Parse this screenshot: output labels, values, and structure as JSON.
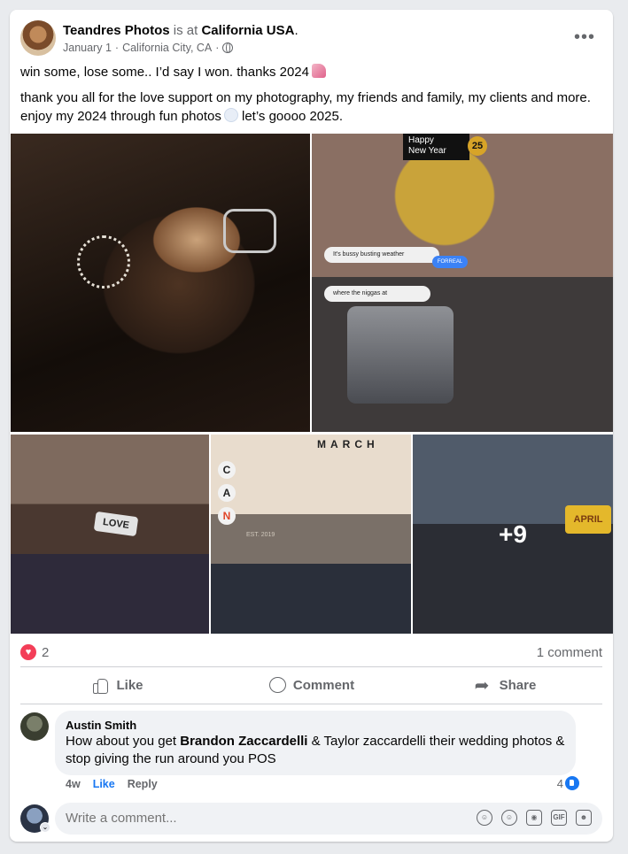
{
  "post": {
    "author": "Teandres Photos",
    "is_at": "is at",
    "location": "California USA",
    "period": ".",
    "date": "January 1",
    "dot": "·",
    "place": "California City, CA",
    "dot2": "·",
    "text_line1": "win some, lose some.. I’d say I won. thanks 2024",
    "text_line2": "thank you all for the love support on my photography, my friends and family, my clients and more. enjoy my 2024 through fun photos",
    "text_line2_end": "let’s goooo 2025.",
    "more_label": "•••"
  },
  "photos": {
    "p2_banner": "Happy\nNew Year",
    "p2_badge": "25",
    "p2_chat1": "It's bussy busting weather",
    "p2_chat2": "where the niggas at",
    "p2_forreal": "FORREAL",
    "p3_love": "LOVE",
    "p4_march": "MARCH",
    "p4_letters": [
      "C",
      "A",
      "N"
    ],
    "p4_est": "EST. 2019",
    "p5_april": "APRIL",
    "more_count": "+9"
  },
  "reactions": {
    "count": "2",
    "comments": "1 comment"
  },
  "actions": {
    "like": "Like",
    "comment": "Comment",
    "share": "Share"
  },
  "comment": {
    "author": "Austin Smith",
    "text_pre": "How about you get",
    "text_bold": "Brandon Zaccardelli",
    "text_post": "& Taylor zaccardelli their wedding photos & stop giving the run around you POS",
    "age": "4w",
    "like": "Like",
    "reply": "Reply",
    "likes": "4"
  },
  "composer": {
    "placeholder": "Write a comment...",
    "icons": [
      "avatar-sticker-icon",
      "emoji-icon",
      "camera-icon",
      "gif-icon",
      "sticker-icon"
    ]
  },
  "colors": {
    "accent": "#1877f2",
    "heart": "#f33e58",
    "muted": "#65676b"
  }
}
